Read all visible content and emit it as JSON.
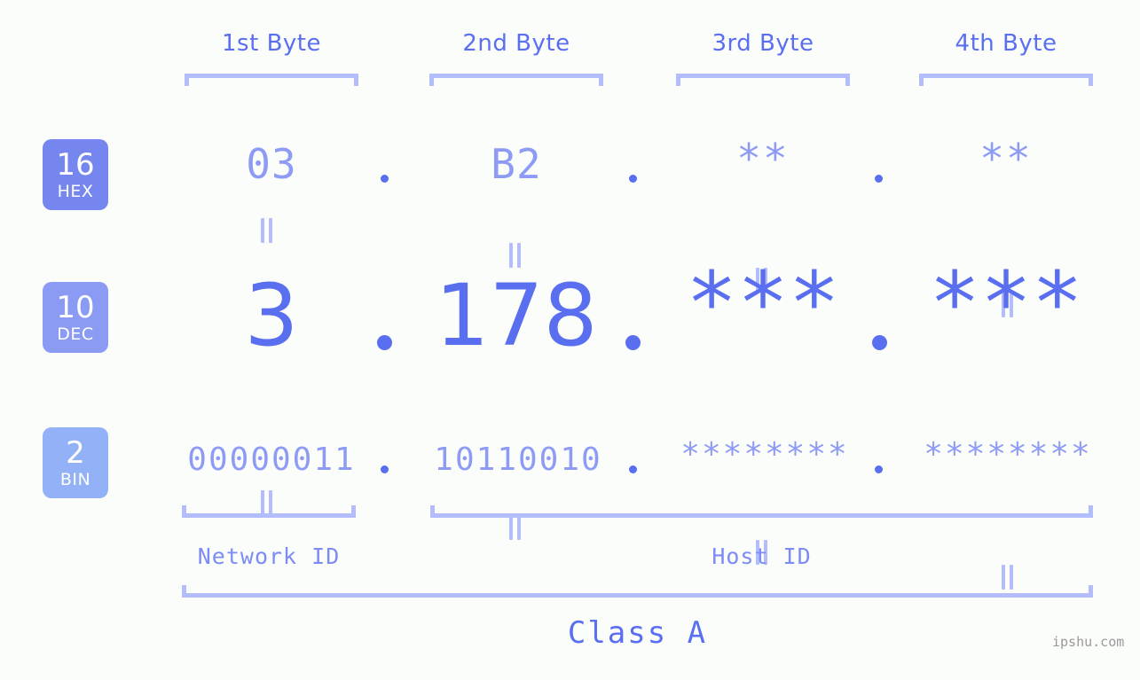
{
  "background_color": "#fbfdfa",
  "accent_color": "#5a6ef0",
  "accent_light_color": "#8e9bf5",
  "bracket_color": "#b3bdfb",
  "headers": {
    "byte1": "1st Byte",
    "byte2": "2nd Byte",
    "byte3": "3rd Byte",
    "byte4": "4th Byte"
  },
  "rows": [
    {
      "badge_number": "16",
      "badge_label": "HEX",
      "badge_color": "#7586ef",
      "values": [
        "03",
        "B2",
        "**",
        "**"
      ],
      "separator": "."
    },
    {
      "badge_number": "10",
      "badge_label": "DEC",
      "badge_color": "#8b9bf3",
      "values": [
        "3",
        "178",
        "***",
        "***"
      ],
      "separator": "."
    },
    {
      "badge_number": "2",
      "badge_label": "BIN",
      "badge_color": "#93b1f7",
      "values": [
        "00000011",
        "10110010",
        "********",
        "********"
      ],
      "separator": "."
    }
  ],
  "equals_glyph": "=",
  "sections": {
    "network_id": "Network ID",
    "host_id": "Host ID",
    "class": "Class A"
  },
  "watermark": "ipshu.com"
}
